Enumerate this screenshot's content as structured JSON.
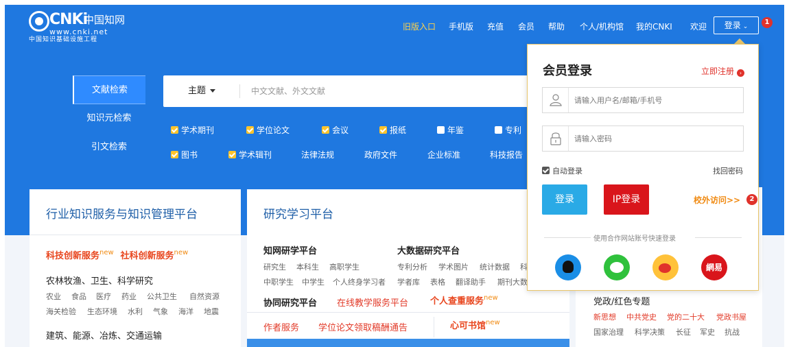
{
  "logo": {
    "word": "CNKi",
    "cn": "中国知网",
    "url": "www.cnki.net",
    "sub": "中国知识基础设施工程"
  },
  "topnav": {
    "items": [
      "旧版入口",
      "手机版",
      "充值",
      "会员",
      "帮助",
      "个人/机构馆",
      "我的CNKI",
      "欢迎"
    ],
    "login": "登录"
  },
  "badges": {
    "one": "1",
    "two": "2"
  },
  "search": {
    "tabs": [
      "文献检索",
      "知识元检索",
      "引文检索"
    ],
    "field": "主题",
    "placeholder": "中文文献、外文文献"
  },
  "filters": {
    "row1": [
      {
        "label": "学术期刊",
        "checked": true
      },
      {
        "label": "学位论文",
        "checked": true
      },
      {
        "label": "会议",
        "checked": true
      },
      {
        "label": "报纸",
        "checked": true
      },
      {
        "label": "年鉴",
        "checked": false
      },
      {
        "label": "专利",
        "checked": false
      }
    ],
    "row2": [
      {
        "label": "图书",
        "checked": true
      },
      {
        "label": "学术辑刊",
        "checked": true
      },
      {
        "label": "法律法规"
      },
      {
        "label": "政府文件"
      },
      {
        "label": "企业标准"
      },
      {
        "label": "科技报告"
      }
    ]
  },
  "card_left": {
    "title": "行业知识服务与知识管理平台",
    "hot1": "科技创新服务",
    "hot2": "社科创新服务",
    "new": "new",
    "sec1": "农林牧渔、卫生、科学研究",
    "links1": [
      "农业",
      "食品",
      "医疗",
      "药业",
      "公共卫生",
      "自然资源"
    ],
    "links2": [
      "海关检验",
      "生态环境",
      "水利",
      "气象",
      "海洋",
      "地震"
    ],
    "sec2": "建筑、能源、冶炼、交通运输"
  },
  "card_mid": {
    "title": "研究学习平台",
    "c1_title": "知网研学平台",
    "c1_links": [
      "研究生",
      "本科生",
      "高职学生"
    ],
    "c1_links2": [
      "中职学生",
      "中学生",
      "个人终身学习者"
    ],
    "c2_title": "大数据研究平台",
    "c2_links": [
      "专利分析",
      "学术图片",
      "统计数据",
      "科"
    ],
    "c2_links2": [
      "学者库",
      "表格",
      "翻译助手",
      "期刊大数"
    ],
    "sec_collab": "协同研究平台",
    "sec_online": "在线教学服务平台",
    "sec_check": "个人查重服务",
    "new": "new",
    "author": "作者服务",
    "thesis": "学位论文领取稿酬通告",
    "book": "心可书馆"
  },
  "card_right": {
    "title": "党政/红色专题",
    "row1": [
      "新思想",
      "中共党史",
      "党的二十大",
      "党政书屋"
    ],
    "row2": [
      "国家治理",
      "科学决策",
      "长征",
      "军史",
      "抗战"
    ]
  },
  "login_popup": {
    "title": "会员登录",
    "register": "立即注册",
    "username_placeholder": "请输入用户名/邮箱/手机号",
    "password_placeholder": "请输入密码",
    "auto_login": "自动登录",
    "forgot": "找回密码",
    "login_btn": "登录",
    "ip_btn": "IP登录",
    "offsite": "校外访问>>",
    "partner": "使用合作网站账号快速登录",
    "netease": "網易"
  },
  "colors": {
    "hero": "#1f78e0",
    "accent_red": "#e0322b",
    "accent_orange": "#f08a12",
    "login_blue": "#2aaae6",
    "ip_red": "#d9151b"
  }
}
